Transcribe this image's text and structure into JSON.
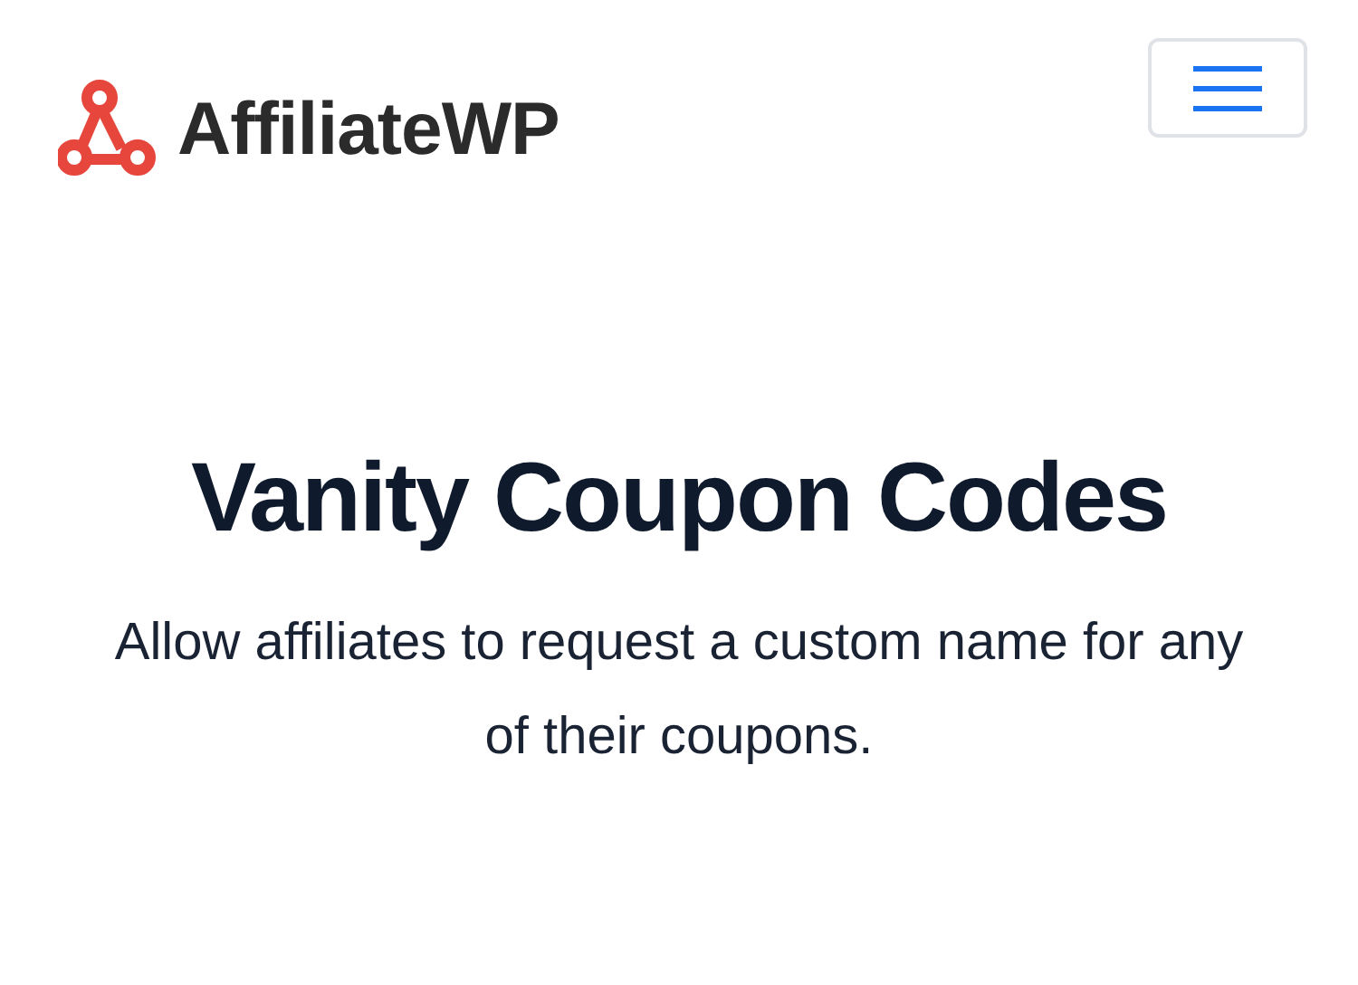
{
  "header": {
    "logo_text": "AffiliateWP",
    "menu_button": {
      "expanded": false
    }
  },
  "hero": {
    "title": "Vanity Coupon Codes",
    "subtitle": "Allow affiliates to request a custom name for any of their coupons."
  }
}
